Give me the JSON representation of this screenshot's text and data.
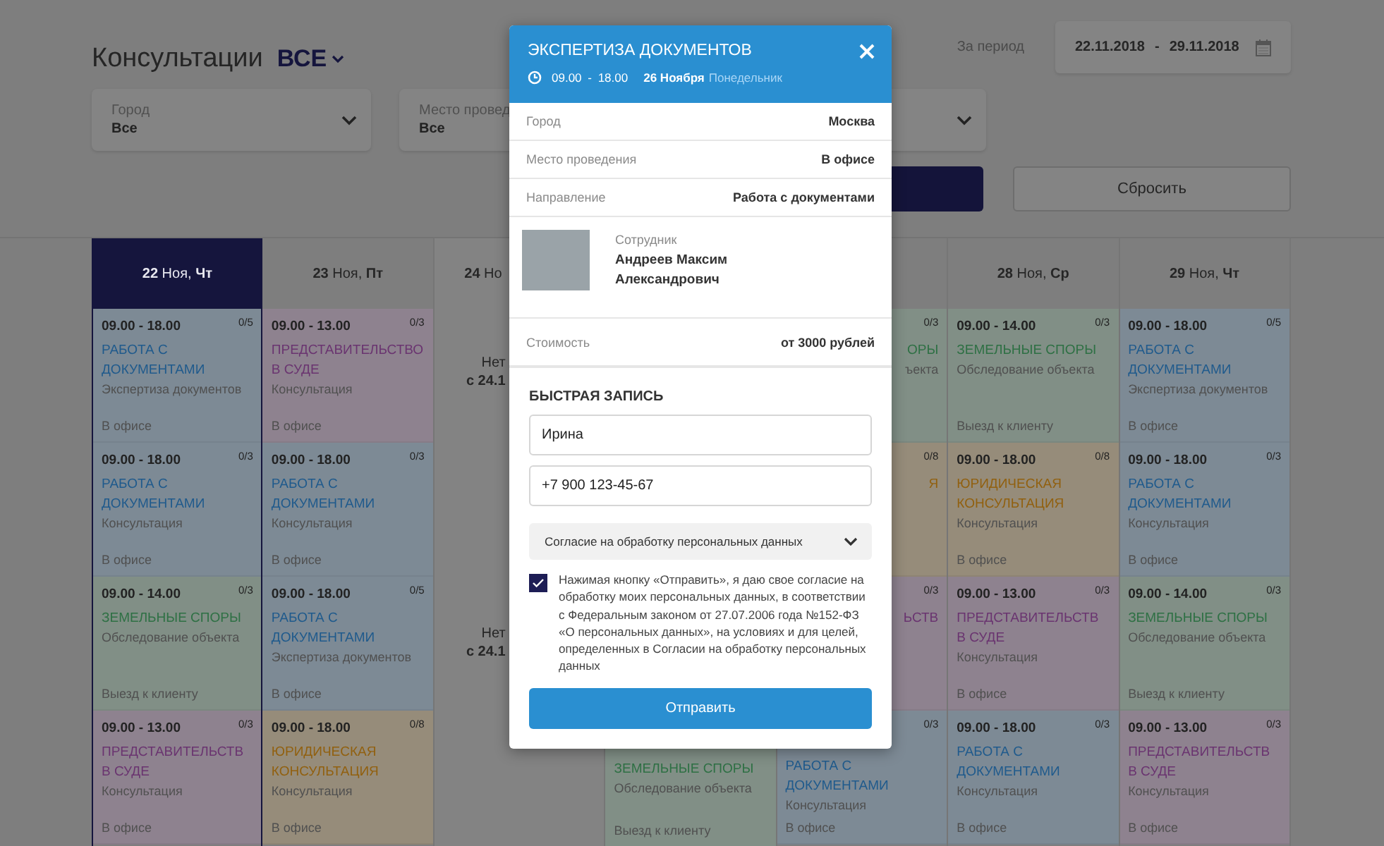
{
  "page": {
    "title": "Консультации",
    "filter_all": "ВСЕ"
  },
  "period": {
    "label": "За период",
    "from": "22.11.2018",
    "separator": "-",
    "to": "29.11.2018"
  },
  "filters": [
    {
      "kind": "select",
      "label": "Город",
      "value": "Все"
    },
    {
      "kind": "select",
      "label": "Место провед",
      "value": "Все"
    },
    {
      "kind": "select"
    }
  ],
  "buttons": [
    {
      "kind": "primary"
    },
    {
      "kind": "secondary",
      "label": "Сбросить"
    }
  ],
  "days": [
    {
      "label": "**22** Ноя, **Чт**",
      "selected": true,
      "kind": "normal",
      "cells": [
        {
          "kind": "full",
          "time": "09.00 - 18.00",
          "count": "0/5",
          "title": "РАБОТА С ДОКУМЕНТАМИ",
          "color": "#1f5a8c",
          "subtitle": "Экспертиза документов",
          "location": "В офисе"
        },
        {
          "kind": "full",
          "time": "09.00 - 18.00",
          "count": "0/3",
          "title": "РАБОТА С ДОКУМЕНТАМИ",
          "color": "#1f5a8c",
          "subtitle": "Консультация",
          "location": "В офисе"
        },
        {
          "kind": "full",
          "time": "09.00 - 14.00",
          "count": "0/3",
          "title": "ЗЕМЕЛЬНЫЕ СПОРЫ",
          "color": "#2e7044",
          "subtitle": "Обследование объекта",
          "location": "Выезд к клиенту"
        },
        {
          "kind": "full",
          "time": "09.00 - 13.00",
          "count": "0/3",
          "title": "ПРЕДСТАВИТЕЛЬСТВ В СУДЕ",
          "color": "#6a3470",
          "subtitle": "Консультация",
          "location": "В офисе"
        }
      ]
    },
    {
      "label": "**23** Ноя, **Пт**",
      "selected": false,
      "kind": "normal",
      "cells": [
        {
          "kind": "full",
          "time": "09.00 - 13.00",
          "count": "0/3",
          "title": "ПРЕДСТАВИТЕЛЬСТВО В СУДЕ",
          "color": "#6a3470",
          "subtitle": "Консультация",
          "location": "В офисе"
        },
        {
          "kind": "full",
          "time": "09.00 - 18.00",
          "count": "0/3",
          "title": "РАБОТА С ДОКУМЕНТАМИ",
          "color": "#1f5a8c",
          "subtitle": "Консультация",
          "location": "В офисе"
        },
        {
          "kind": "full",
          "time": "09.00 - 18.00",
          "count": "0/5",
          "title": "РАБОТА С ДОКУМЕНТАМИ",
          "color": "#1f5a8c",
          "subtitle": "Экспертиза документов",
          "location": "В офисе"
        },
        {
          "kind": "full",
          "time": "09.00 - 18.00",
          "count": "0/8",
          "title": "ЮРИДИЧЕСКАЯ КОНСУЛЬТАЦИЯ",
          "color": "#91600f",
          "subtitle": "Консультация",
          "location": "В офисе"
        }
      ]
    },
    {
      "label": "**24** Но",
      "selected": false,
      "kind": "weekend",
      "notes": [
        {
          "lines": [
            "Нет",
            "с 24.1"
          ]
        },
        {
          "lines": [
            "Нет",
            "с 24.1"
          ]
        }
      ]
    },
    {
      "selected": false,
      "kind": "covered",
      "cells": [
        {
          "kind": "full",
          "title": "ЗЕМЕЛЬНЫЕ СПОРЫ",
          "color": "#2e7044",
          "subtitle": "Обследование объекта",
          "location": "Выезд к клиенту"
        }
      ]
    },
    {
      "selected": false,
      "kind": "normal",
      "cells": [
        {
          "kind": "fragment",
          "count": "0/3",
          "title": "ОРЫ",
          "color": "#2e7044",
          "subtitle": "ъекта"
        },
        {
          "kind": "fragment",
          "count": "0/8",
          "title": "Я",
          "color": "#91600f"
        },
        {
          "kind": "fragment",
          "count": "0/3",
          "title": "ЬСТВ",
          "color": "#6a3470"
        },
        {
          "kind": "full",
          "count": "0/3",
          "title": "РАБОТА С ДОКУМЕНТАМИ",
          "color": "#1f5a8c",
          "subtitle": "Консультация",
          "location": "В офисе"
        }
      ]
    },
    {
      "label": "**28** Ноя, **Ср**",
      "selected": false,
      "kind": "normal",
      "cells": [
        {
          "kind": "full",
          "time": "09.00 - 14.00",
          "count": "0/3",
          "title": "ЗЕМЕЛЬНЫЕ СПОРЫ",
          "color": "#2e7044",
          "subtitle": "Обследование объекта",
          "location": "Выезд к клиенту"
        },
        {
          "kind": "full",
          "time": "09.00 - 18.00",
          "count": "0/8",
          "title": "ЮРИДИЧЕСКАЯ КОНСУЛЬТАЦИЯ",
          "color": "#91600f",
          "subtitle": "Консультация",
          "location": "В офисе"
        },
        {
          "kind": "full",
          "time": "09.00 - 13.00",
          "count": "0/3",
          "title": "ПРЕДСТАВИТЕЛЬСТВ В СУДЕ",
          "color": "#6a3470",
          "subtitle": "Консультация",
          "location": "В офисе"
        },
        {
          "kind": "full",
          "time": "09.00 - 18.00",
          "count": "0/3",
          "title": "РАБОТА С ДОКУМЕНТАМИ",
          "color": "#1f5a8c",
          "subtitle": "Консультация",
          "location": "В офисе"
        }
      ]
    },
    {
      "label": "**29** Ноя, **Чт**",
      "selected": false,
      "kind": "normal",
      "cells": [
        {
          "kind": "full",
          "time": "09.00 - 18.00",
          "count": "0/5",
          "title": "РАБОТА С ДОКУМЕНТАМИ",
          "color": "#1f5a8c",
          "subtitle": "Экспертиза документов",
          "location": "В офисе"
        },
        {
          "kind": "full",
          "time": "09.00 - 18.00",
          "count": "0/3",
          "title": "РАБОТА С ДОКУМЕНТАМИ",
          "color": "#1f5a8c",
          "subtitle": "Консультация",
          "location": "В офисе"
        },
        {
          "kind": "full",
          "time": "09.00 - 14.00",
          "count": "0/3",
          "title": "ЗЕМЕЛЬНЫЕ СПОРЫ",
          "color": "#2e7044",
          "subtitle": "Обследование объекта",
          "location": "Выезд к клиенту"
        },
        {
          "kind": "full",
          "time": "09.00 - 13.00",
          "count": "0/3",
          "title": "ПРЕДСТАВИТЕЛЬСТВ В СУДЕ",
          "color": "#6a3470",
          "subtitle": "Консультация",
          "location": "В офисе"
        }
      ]
    }
  ],
  "modal": {
    "title": "ЭКСПЕРТИЗА ДОКУМЕНТОВ",
    "time": "09.00 - 18.00",
    "date": "26 Ноября",
    "weekday": "Понедельник",
    "details": [
      {
        "label": "Город",
        "value": "Москва"
      },
      {
        "label": "Место проведения",
        "value": "В офисе"
      },
      {
        "label": "Направление",
        "value": "Работа с документами"
      }
    ],
    "employee": {
      "label": "Сотрудник",
      "name": "Андреев Максим Александрович"
    },
    "cost": {
      "label": "Стоимость",
      "value": "от 3000 рублей"
    },
    "form": {
      "heading": "БЫСТРАЯ ЗАПИСЬ",
      "name": "Ирина",
      "phone": "+7 900 123-45-67",
      "consent_select": "Согласие на обработку персональных данных",
      "consent_checked": true,
      "consent_text": "Нажимая кнопку «Отправить», я даю свое согласие на обработку моих персональных данных, в соответствии с Федеральным законом от 27.07.2006 года №152-ФЗ «О персональных данных», на условиях и для целей, определенных в Согласии на обработку персональных данных",
      "submit": "Отправить"
    }
  }
}
